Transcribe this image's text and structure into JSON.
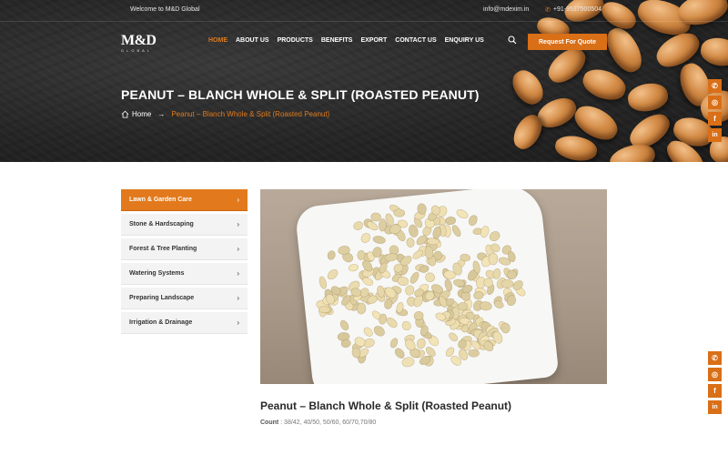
{
  "topbar": {
    "welcome": "Welcome to M&D Global",
    "email": "info@mdexim.in",
    "phone": "+91-9537500504"
  },
  "logo": {
    "mark": "M&D",
    "sub": "GLOBAL"
  },
  "nav": {
    "items": [
      {
        "label": "HOME",
        "active": true
      },
      {
        "label": "ABOUT US",
        "active": false
      },
      {
        "label": "PRODUCTS",
        "active": false
      },
      {
        "label": "BENEFITS",
        "active": false
      },
      {
        "label": "EXPORT",
        "active": false
      },
      {
        "label": "CONTACT US",
        "active": false
      },
      {
        "label": "ENQUIRY US",
        "active": false
      }
    ],
    "quote_button": "Request For Quote"
  },
  "page": {
    "title": "PEANUT – BLANCH WHOLE & SPLIT (ROASTED PEANUT)"
  },
  "breadcrumb": {
    "home": "Home",
    "separator": "→",
    "current": "Peanut – Blanch Whole & Split (Roasted Peanut)"
  },
  "sidebar": {
    "items": [
      {
        "label": "Lawn & Garden Care",
        "active": true
      },
      {
        "label": "Stone & Hardscaping",
        "active": false
      },
      {
        "label": "Forest & Tree Planting",
        "active": false
      },
      {
        "label": "Watering Systems",
        "active": false
      },
      {
        "label": "Preparing Landscape",
        "active": false
      },
      {
        "label": "Irrigation & Drainage",
        "active": false
      }
    ]
  },
  "product": {
    "name": "Peanut – Blanch Whole & Split (Roasted Peanut)",
    "count_label": "Count",
    "count_value": ": 38/42, 40/50, 50/60, 60/70,70/80"
  },
  "social": {
    "icons": [
      "phone-icon",
      "whatsapp-icon",
      "facebook-icon",
      "linkedin-icon"
    ]
  },
  "colors": {
    "accent": "#d96f17",
    "hero_bg": "#262626"
  }
}
